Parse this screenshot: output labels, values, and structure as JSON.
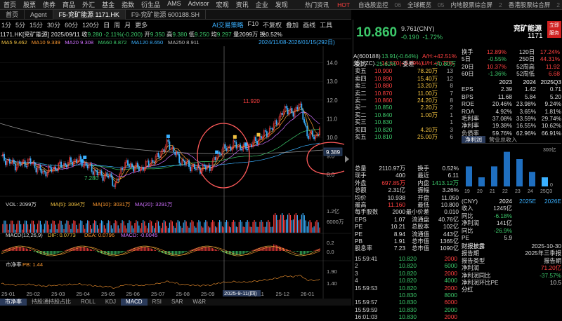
{
  "topnav": [
    "首页",
    "股票",
    "债券",
    "商品",
    "外汇",
    "基金",
    "指数",
    "衍生品",
    "AMS",
    "Advisor",
    "宏观",
    "资讯",
    "企业",
    "发现"
  ],
  "topright": [
    "热门资讯",
    "HOT",
    "自选股监控",
    "06",
    "全球概览",
    "05",
    "内地股票综合屏",
    "2",
    "香港股票综合屏",
    "2"
  ],
  "tabs": [
    {
      "label": "Agent",
      "active": false
    },
    {
      "label": "F5-兖矿能源 1171.HK",
      "active": true
    },
    {
      "label": "F9-兖矿能源 600188.SH",
      "active": false
    }
  ],
  "periods": [
    "日",
    "周",
    "月",
    "更多"
  ],
  "periods2": [
    "1分",
    "5分",
    "15分",
    "30分",
    "60分",
    "120分"
  ],
  "toolbar": [
    "AI交易策略",
    "F10",
    "不复权",
    "叠加",
    "画线",
    "工具"
  ],
  "info": {
    "code": "1171.HK[兖矿能源]",
    "date": "2025/09/11",
    "close_label": "收",
    "close": "9.280",
    "chg": "-2.11%(-0.200)",
    "open_label": "开",
    "open": "9.350",
    "high_label": "高",
    "high": "9.380",
    "low_label": "低",
    "low": "9.250",
    "avg_label": "均",
    "avg": "9.297",
    "vol_label": "量",
    "vol": "2099万",
    "turn_label": "换",
    "turn": "0.52%"
  },
  "ma": [
    {
      "name": "MA5",
      "val": "9.462",
      "color": "#f0c040"
    },
    {
      "name": "MA10",
      "val": "9.339",
      "color": "#ff9a30"
    },
    {
      "name": "MA20",
      "val": "9.308",
      "color": "#d070ff"
    },
    {
      "name": "MA60",
      "val": "8.872",
      "color": "#3cc86a"
    },
    {
      "name": "MA120",
      "val": "8.650",
      "color": "#3ab0ff"
    },
    {
      "name": "MA250",
      "val": "8.911",
      "color": "#bbbbbb"
    }
  ],
  "range": "2024/11/08-2026/01/15(292日)",
  "yaxis": [
    "14.0",
    "13.0",
    "12.0",
    "11.0",
    "10.0",
    "9.0",
    "8.0"
  ],
  "xaxis": [
    "25-01",
    "25-02",
    "25-03",
    "25-04",
    "25-05",
    "25-06",
    "25-07",
    "25-08",
    "25-09",
    "25-10",
    "25-11",
    "25-12",
    "26-01"
  ],
  "crosshair": {
    "date": "2025-9-11(四)",
    "price": "9.389"
  },
  "labels": {
    "high": "11.920",
    "low": "7.280"
  },
  "vol": {
    "title": "VOL: 2099万",
    "ma5": "MA(5): 3094万",
    "ma10": "MA(10): 3031万",
    "ma20": "MA(20): 3291万",
    "y1": "1.2亿",
    "y2": "6000万"
  },
  "macd": {
    "title": "MACD(12,26,9)",
    "dif": "DIF: 0.0773",
    "dea": "DEA: 0.0796",
    "macd": "MACD: -0.0045",
    "y1": "0.2",
    "y2": "0.0"
  },
  "pb": {
    "title": "市净率",
    "val": "PB: 1.44",
    "y1": "1.90",
    "y2": "1.40"
  },
  "bottomtabs": [
    "市净率",
    "持股通持股占比",
    "ROLL",
    "KDJ",
    "MACD",
    "RSI",
    "SAR",
    "W&R"
  ],
  "quote": {
    "price": "10.860",
    "ref": "9.761(CNY)",
    "chg": "-0.190",
    "pct": "-1.72%",
    "name": "兖矿能源",
    "code": "1171",
    "badge": "立即\n服务"
  },
  "stats": [
    [
      "日",
      ""
    ],
    [
      "换手",
      "12.89%"
    ],
    [
      "120日",
      "17.24%"
    ],
    [
      "5日",
      "-0.55%"
    ],
    [
      "250日",
      "44.31%"
    ],
    [
      "20日",
      "10.37%"
    ],
    [
      "52周高",
      "11.92"
    ],
    [
      "60日",
      "-1.36%"
    ],
    [
      "52周低",
      "6.68"
    ]
  ],
  "aline": {
    "a": "A(600188)",
    "av": "13.91(-0.64%)",
    "ah": "A/H:+42.51%"
  },
  "mline": {
    "m": "美(YZC)",
    "mv": "14.170(+2.09%)",
    "mu": "U/H:+1.77%"
  },
  "weibi": {
    "label": "委比",
    "val": "-25.62%",
    "label2": "委差",
    "val2": "-70.80万"
  },
  "asks": [
    [
      "卖五",
      "10.900",
      "78.20万",
      "13"
    ],
    [
      "卖四",
      "10.890",
      "15.40万",
      "12"
    ],
    [
      "卖三",
      "10.880",
      "13.20万",
      "8"
    ],
    [
      "卖二",
      "10.870",
      "11.00万",
      "7"
    ],
    [
      "卖一",
      "10.860",
      "24.20万",
      "8"
    ]
  ],
  "bids": [
    [
      "买一",
      "10.850",
      "2.20万",
      "2"
    ],
    [
      "买二",
      "10.840",
      "1.00万",
      "1"
    ],
    [
      "买三",
      "10.830",
      "",
      "1"
    ],
    [
      "买四",
      "10.820",
      "4.20万",
      "3"
    ],
    [
      "买五",
      "10.810",
      "25.00万",
      "6"
    ]
  ],
  "fin": {
    "head": [
      "",
      "2023",
      "2024",
      "2025Q3"
    ],
    "rows": [
      [
        "EPS",
        "2.39",
        "1.42",
        "0.71"
      ],
      [
        "BPS",
        "11.68",
        "5.84",
        "5.20"
      ],
      [
        "ROE",
        "20.46%",
        "23.98%",
        "9.24%"
      ],
      [
        "ROA",
        "4.92%",
        "3.65%",
        "1.81%"
      ],
      [
        "毛利率",
        "37.08%",
        "33.59%",
        "29.74%"
      ],
      [
        "净利率",
        "19.38%",
        "16.55%",
        "10.62%"
      ],
      [
        "负债率",
        "59.76%",
        "62.96%",
        "66.91%"
      ]
    ]
  },
  "fintabs": [
    "净利润",
    "营业总收入"
  ],
  "trade": [
    [
      "总量",
      "2110.97万",
      "换手",
      "0.52%"
    ],
    [
      "现手",
      "400",
      "最近",
      "6.11"
    ],
    [
      "外盘",
      "697.85万",
      "内盘",
      "1413.12万"
    ],
    [
      "总额",
      "2.31亿",
      "振幅",
      "3.26%"
    ],
    [
      "均价",
      "10.938",
      "开盘",
      "11.050"
    ],
    [
      "最高",
      "11.160",
      "最低",
      "10.800"
    ],
    [
      "每手股数",
      "2000",
      "最小价差",
      "0.010"
    ],
    [
      "EPS",
      "1.07",
      "流通盘",
      "40.76亿"
    ],
    [
      "PE",
      "10.21",
      "总股本",
      "102亿"
    ],
    [
      "PE",
      "8.94",
      "流通值",
      "443亿"
    ],
    [
      "PB",
      "1.91",
      "总市值",
      "1365亿"
    ],
    [
      "股息率",
      "7.23",
      "总市值",
      "1090亿"
    ]
  ],
  "ticks": [
    [
      "15:59:41",
      "10.820",
      "2000"
    ],
    [
      "2",
      "10.820",
      "6000"
    ],
    [
      "3",
      "10.820",
      "2000"
    ],
    [
      "4",
      "10.820",
      "4000"
    ],
    [
      "15:59:53",
      "10.820",
      "2000"
    ],
    [
      "",
      "10.830",
      "8000"
    ],
    [
      "15:59:57",
      "10.830",
      "6000"
    ],
    [
      "15:59:59",
      "10.830",
      "2000"
    ],
    [
      "16:01:03",
      "10.830",
      "2000"
    ]
  ],
  "barchart": {
    "years": [
      "19",
      "20",
      "21",
      "22",
      "23",
      "24",
      "25Q3"
    ],
    "values": [
      0.55,
      0.25,
      0.55,
      0.95,
      0.75,
      0.4,
      0.25
    ],
    "y": [
      "300亿",
      "0"
    ]
  },
  "forecast": {
    "head": [
      "(CNY)",
      "2024",
      "2025E",
      "2026E"
    ],
    "rows": [
      [
        "收入",
        "1245亿",
        "",
        ""
      ],
      [
        "同比",
        "-6.18%",
        "",
        ""
      ],
      [
        "净利润",
        "141亿",
        "",
        ""
      ],
      [
        "同比",
        "-26.9%",
        "",
        ""
      ],
      [
        "PE",
        "5.9",
        "",
        ""
      ]
    ]
  },
  "report": {
    "title": "财报披露",
    "date": "2025-10-30",
    "rows": [
      [
        "报告期",
        "2025年三季报"
      ],
      [
        "报告类型",
        "报告期"
      ],
      [
        "净利润",
        "71.20亿"
      ],
      [
        "净利润同比",
        "-37.57%"
      ],
      [
        "净利润环比PE",
        "10.5"
      ]
    ]
  },
  "fenhong": "分红"
}
